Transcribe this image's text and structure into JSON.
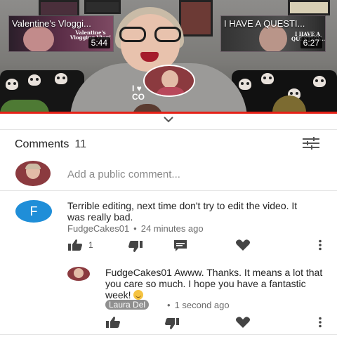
{
  "video": {
    "thumbnails": [
      {
        "title": "Valentine's Vloggi...",
        "subtitle": "Valentine's Vlogging Vlog!",
        "duration": "5:44"
      },
      {
        "title": "I HAVE A QUESTI...",
        "subtitle": "I HAVE A QUESTION...",
        "duration": "6:27"
      }
    ],
    "sweater_text": "I ♥\nCO",
    "progress": 1.0,
    "accent_color": "#e62117"
  },
  "comments": {
    "title": "Comments",
    "count": "11",
    "sort_icon": "sort-filter-icon",
    "add_placeholder": "Add a public comment..."
  },
  "comment": {
    "avatar_letter": "F",
    "avatar_color": "#1f8ed8",
    "text": "Terrible editing, next time don't try to edit the video.  It was really bad.",
    "author": "FudgeCakes01",
    "time": "24 minutes ago",
    "likes": "1"
  },
  "reply": {
    "text": "FudgeCakes01 Awww. Thanks. It means a lot that you care so much. I hope you have a fantastic week! ",
    "author": "Laura Del",
    "time": "1 second ago"
  },
  "icons": {
    "like": "thumbs-up-icon",
    "dislike": "thumbs-down-icon",
    "reply": "reply-icon",
    "heart": "heart-icon",
    "more": "more-vert-icon",
    "collapse": "chevron-down-icon"
  }
}
